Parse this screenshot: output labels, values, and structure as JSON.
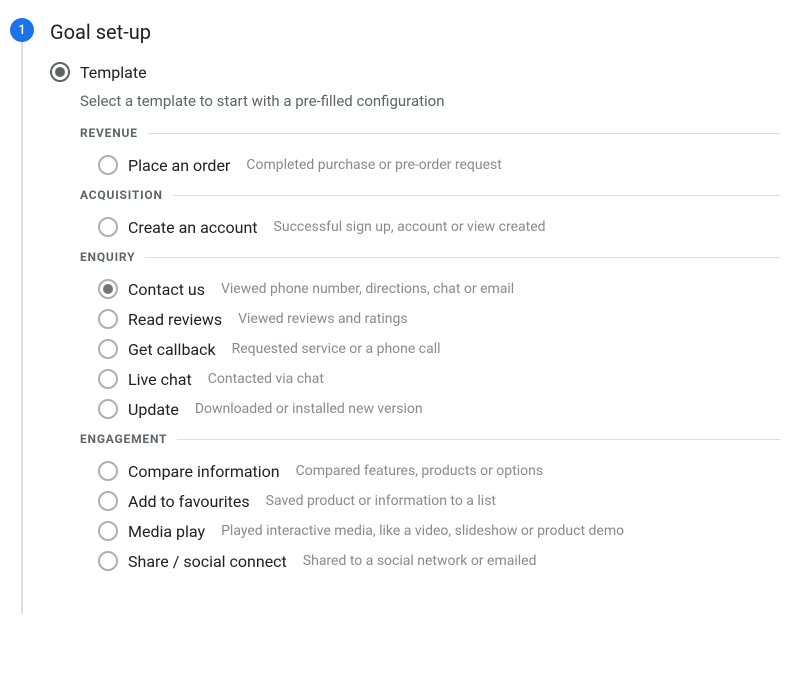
{
  "step": {
    "number": "1",
    "title": "Goal set-up"
  },
  "template": {
    "label": "Template",
    "desc": "Select a template to start with a pre-filled configuration"
  },
  "categories": [
    {
      "name": "REVENUE",
      "options": [
        {
          "label": "Place an order",
          "desc": "Completed purchase or pre-order request",
          "selected": false
        }
      ]
    },
    {
      "name": "ACQUISITION",
      "options": [
        {
          "label": "Create an account",
          "desc": "Successful sign up, account or view created",
          "selected": false
        }
      ]
    },
    {
      "name": "ENQUIRY",
      "options": [
        {
          "label": "Contact us",
          "desc": "Viewed phone number, directions, chat or email",
          "selected": true
        },
        {
          "label": "Read reviews",
          "desc": "Viewed reviews and ratings",
          "selected": false
        },
        {
          "label": "Get callback",
          "desc": "Requested service or a phone call",
          "selected": false
        },
        {
          "label": "Live chat",
          "desc": "Contacted via chat",
          "selected": false
        },
        {
          "label": "Update",
          "desc": "Downloaded or installed new version",
          "selected": false
        }
      ]
    },
    {
      "name": "ENGAGEMENT",
      "options": [
        {
          "label": "Compare information",
          "desc": "Compared features, products or options",
          "selected": false
        },
        {
          "label": "Add to favourites",
          "desc": "Saved product or information to a list",
          "selected": false
        },
        {
          "label": "Media play",
          "desc": "Played interactive media, like a video, slideshow or product demo",
          "selected": false
        },
        {
          "label": "Share / social connect",
          "desc": "Shared to a social network or emailed",
          "selected": false
        }
      ]
    }
  ]
}
